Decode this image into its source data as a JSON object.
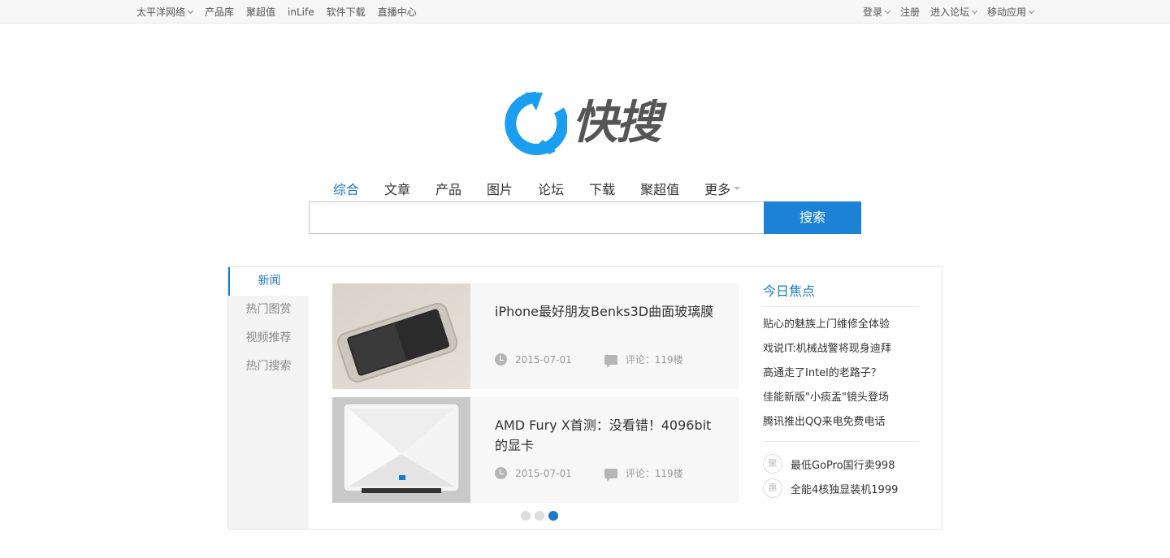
{
  "topbar": {
    "left": [
      {
        "label": "太平洋网络",
        "dropdown": true
      },
      {
        "label": "产品库",
        "dropdown": false
      },
      {
        "label": "聚超值",
        "dropdown": false
      },
      {
        "label": "inLife",
        "dropdown": false
      },
      {
        "label": "软件下载",
        "dropdown": false
      },
      {
        "label": "直播中心",
        "dropdown": false
      }
    ],
    "right": [
      {
        "label": "登录",
        "dropdown": true
      },
      {
        "label": "注册",
        "dropdown": false
      },
      {
        "label": "进入论坛",
        "dropdown": true
      },
      {
        "label": "移动应用",
        "dropdown": true
      }
    ]
  },
  "logo": {
    "text": "快搜",
    "icon": "refresh-q-icon",
    "color": "#1b9ef0"
  },
  "search": {
    "tabs": [
      "综合",
      "文章",
      "产品",
      "图片",
      "论坛",
      "下载",
      "聚超值",
      "更多"
    ],
    "active_tab": "综合",
    "input_value": "",
    "button_label": "搜索",
    "accent": "#1b82d6"
  },
  "sidebar": {
    "items": [
      "新闻",
      "热门图赏",
      "视频推荐",
      "热门搜索"
    ],
    "active": "新闻"
  },
  "news": [
    {
      "title": "iPhone最好朋友Benks3D曲面玻璃膜",
      "date": "2015-07-01",
      "comments": "评论：119楼"
    },
    {
      "title": "AMD Fury X首测：没看错！4096bit的显卡",
      "date": "2015-07-01",
      "comments": "评论：119楼"
    }
  ],
  "carousel": {
    "count": 3,
    "active_index": 2
  },
  "focus": {
    "title": "今日焦点",
    "items": [
      "贴心的魅族上门维修全体验",
      "戏说IT:机械战警将现身迪拜",
      "高通走了Intel的老路子？",
      "佳能新版\"小痰盂\"镜头登场",
      "腾讯推出QQ来电免费电话"
    ],
    "deals": [
      {
        "badge": "聚",
        "text": "最低GoPro国行卖998"
      },
      {
        "badge": "惠",
        "text": "全能4核独显装机1999"
      }
    ]
  }
}
